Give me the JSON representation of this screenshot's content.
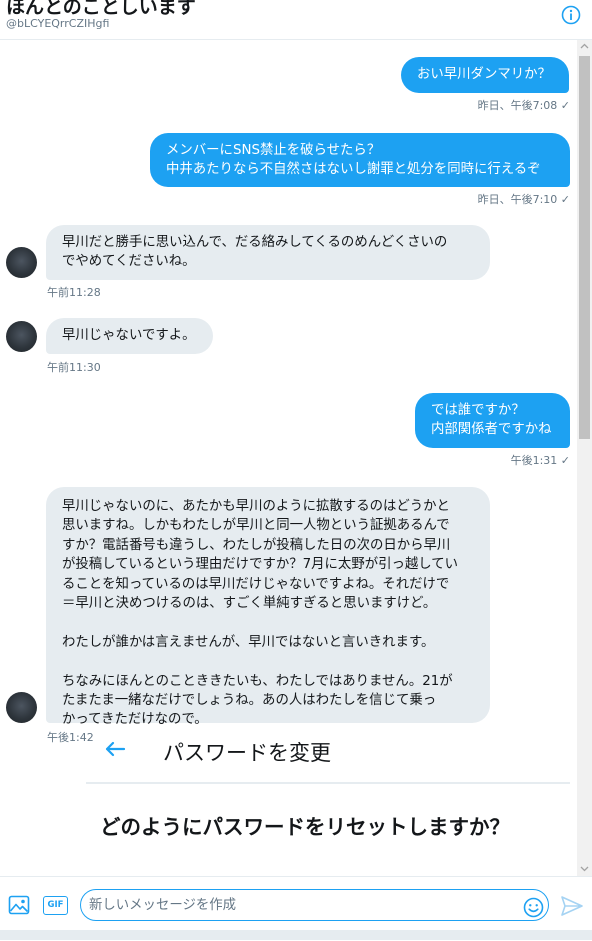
{
  "header": {
    "title": "ほんとのことしいます",
    "handle": "@bLCYEQrrCZIHgfi",
    "info_icon": "info-icon"
  },
  "colors": {
    "accent": "#1da1f2",
    "incoming_bubble": "#e6ecf0",
    "meta_text": "#657786"
  },
  "messages": [
    {
      "direction": "sent",
      "text": "おい早川ダンマリか？",
      "time": "昨日、午後7:08 ✓"
    },
    {
      "direction": "sent",
      "text": "メンバーにSNS禁止を破らせたら？\n中井あたりなら不自然さはないし謝罪と処分を同時に行えるぞ",
      "time": "昨日、午後7:10 ✓"
    },
    {
      "direction": "received",
      "text": "早川だと勝手に思い込んで、だる絡みしてくるのめんどくさいの\nでやめてくださいね。",
      "time": "午前11:28"
    },
    {
      "direction": "received",
      "text": "早川じゃないですよ。",
      "time": "午前11:30"
    },
    {
      "direction": "sent",
      "text": "では誰ですか？\n内部関係者ですかね",
      "time": "午後1:31 ✓"
    },
    {
      "direction": "received",
      "text": "早川じゃないのに、あたかも早川のように拡散するのはどうかと\n思いますね。しかもわたしが早川と同一人物という証拠あるんで\nすか？電話番号も違うし、わたしが投稿した日の次の日から早川\nが投稿しているという理由だけですか？7月に太野が引っ越してい\nることを知っているのは早川だけじゃないですよね。それだけで\n＝早川と決めつけるのは、すごく単純すぎると思いますけど。\n\nわたしが誰かは言えませんが、早川ではないと言いきれます。\n\nちなみにほんとのことききたいも、わたしではありません。21が\nたまたま一緒なだけでしょうね。あの人はわたしを信じて乗っ\nかってきただけなので。",
      "time": "午後1:42"
    }
  ],
  "password_card": {
    "back_icon": "back-arrow-icon",
    "title": "パスワードを変更",
    "question": "どのようにパスワードをリセットしますか？"
  },
  "composer": {
    "image_icon": "image-icon",
    "gif_label": "GIF",
    "placeholder": "新しいメッセージを作成",
    "emoji_icon": "emoji-icon",
    "send_icon": "send-icon"
  }
}
